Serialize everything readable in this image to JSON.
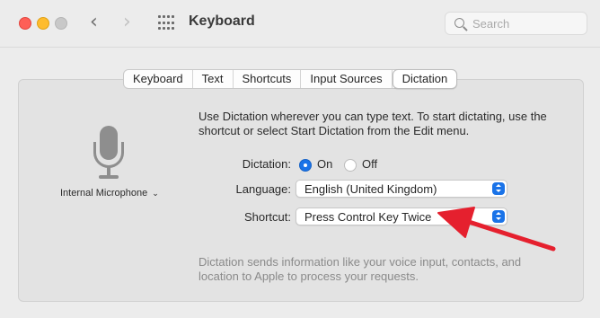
{
  "window": {
    "title": "Keyboard",
    "search_placeholder": "Search",
    "icons": [
      "close-button",
      "minimize-button",
      "zoom-button",
      "back-chevron-icon",
      "forward-chevron-icon",
      "grid-icon",
      "search-icon"
    ]
  },
  "tabs": [
    {
      "label": "Keyboard",
      "active": false
    },
    {
      "label": "Text",
      "active": false
    },
    {
      "label": "Shortcuts",
      "active": false
    },
    {
      "label": "Input Sources",
      "active": false
    },
    {
      "label": "Dictation",
      "active": true
    }
  ],
  "microphone": {
    "icon": "microphone-icon",
    "label": "Internal Microphone",
    "chevron": "⌄"
  },
  "description": "Use Dictation wherever you can type text. To start dictating, use the shortcut or select Start Dictation from the Edit menu.",
  "dictation": {
    "label": "Dictation:",
    "on_label": "On",
    "off_label": "Off",
    "selected": "On"
  },
  "language": {
    "label": "Language:",
    "value": "English (United Kingdom)"
  },
  "shortcut": {
    "label": "Shortcut:",
    "value": "Press Control Key Twice"
  },
  "footer": "Dictation sends information like your voice input, contacts, and location to Apple to process your requests.",
  "colors": {
    "accent": "#1a73e8",
    "annotation_arrow": "#e5202e",
    "close": "#fe5f57",
    "minimize": "#febc2e"
  }
}
